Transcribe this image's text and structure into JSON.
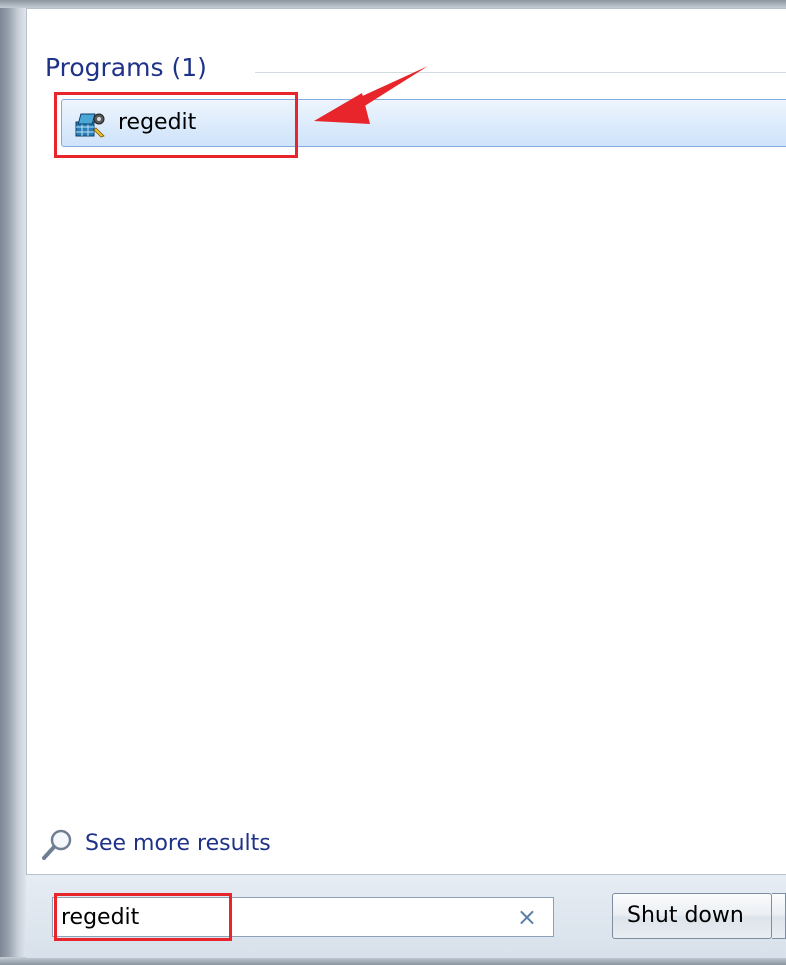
{
  "start_menu": {
    "section_header": "Programs (1)",
    "results": [
      {
        "label": "regedit",
        "icon": "registry-editor-icon"
      }
    ],
    "see_more_label": "See more results",
    "search": {
      "value": "regedit",
      "clear_icon": "×"
    },
    "shutdown_label": "Shut down"
  },
  "colors": {
    "annotation": "#e8252a",
    "header_text": "#1e3287",
    "selection": "#dcebfc"
  }
}
